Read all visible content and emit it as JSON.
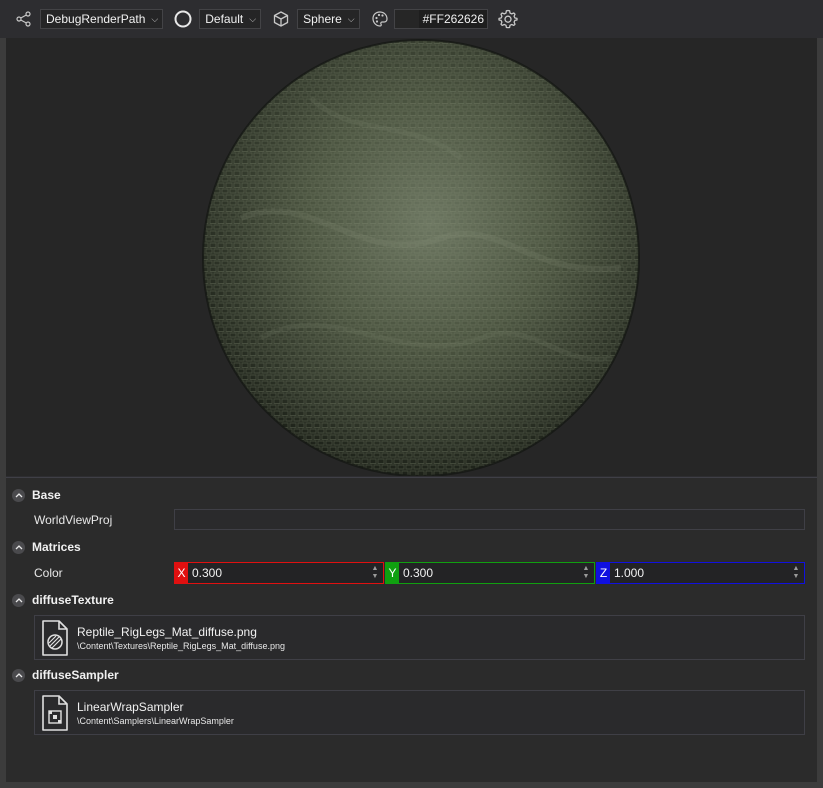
{
  "toolbar": {
    "render_path": "DebugRenderPath",
    "shading": "Default",
    "mesh": "Sphere",
    "background_color": "#FF262626"
  },
  "viewport": {
    "preview": "material-sphere"
  },
  "sections": {
    "base": {
      "title": "Base",
      "worldviewproj_label": "WorldViewProj"
    },
    "matrices": {
      "title": "Matrices",
      "color_label": "Color",
      "x_axis": "X",
      "x_value": "0.300",
      "y_axis": "Y",
      "y_value": "0.300",
      "z_axis": "Z",
      "z_value": "1.000"
    },
    "diffuse_texture": {
      "title": "diffuseTexture",
      "file_name": "Reptile_RigLegs_Mat_diffuse.png",
      "file_path": "\\Content\\Textures\\Reptile_RigLegs_Mat_diffuse.png"
    },
    "diffuse_sampler": {
      "title": "diffuseSampler",
      "name": "LinearWrapSampler",
      "path": "\\Content\\Samplers\\LinearWrapSampler"
    }
  },
  "colors": {
    "background": "#2d2d30",
    "viewport": "#262626",
    "x_axis": "#e01010",
    "y_axis": "#10a010",
    "z_axis": "#1010e0"
  }
}
